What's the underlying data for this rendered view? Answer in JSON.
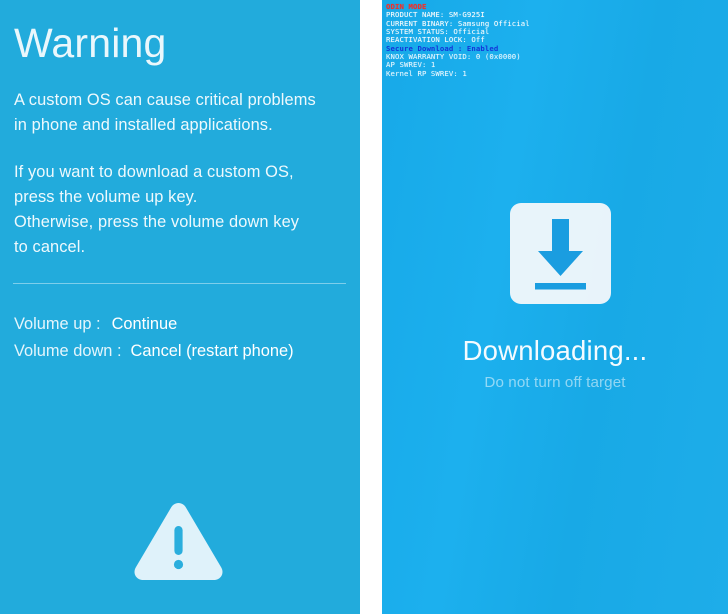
{
  "warning_screen": {
    "title": "Warning",
    "body_1": "A custom OS can cause critical problems\nin phone and installed applications.",
    "body_2": "If you want to download a custom OS,\npress the volume up key.\nOtherwise, press the volume down key\nto cancel.",
    "keys": {
      "up_label": "Volume up :",
      "up_action": "Continue",
      "down_label": "Volume down :",
      "down_action": "Cancel (restart phone)"
    },
    "icon": "warning-triangle-icon",
    "background_color": "#22abdc",
    "text_color": "#eef9fd"
  },
  "download_screen": {
    "odin_info": [
      {
        "text": "ODIN MODE",
        "style": "header"
      },
      {
        "text": "PRODUCT NAME: SM-G925I",
        "style": "normal"
      },
      {
        "text": "CURRENT BINARY: Samsung Official",
        "style": "normal"
      },
      {
        "text": "SYSTEM STATUS: Official",
        "style": "normal"
      },
      {
        "text": "REACTIVATION LOCK: Off",
        "style": "normal"
      },
      {
        "text": "Secure Download : Enabled",
        "style": "accent"
      },
      {
        "text": "KNOX WARRANTY VOID: 0 (0x0000)",
        "style": "dim"
      },
      {
        "text": "AP SWREV: 1",
        "style": "dim"
      },
      {
        "text": "Kernel RP SWREV: 1",
        "style": "dim"
      }
    ],
    "icon": "download-arrow-icon",
    "status_title": "Downloading...",
    "status_subtext": "Do not turn off target",
    "background_color": "#1aace8",
    "header_color": "#f0312a",
    "accent_color": "#1434d8"
  }
}
